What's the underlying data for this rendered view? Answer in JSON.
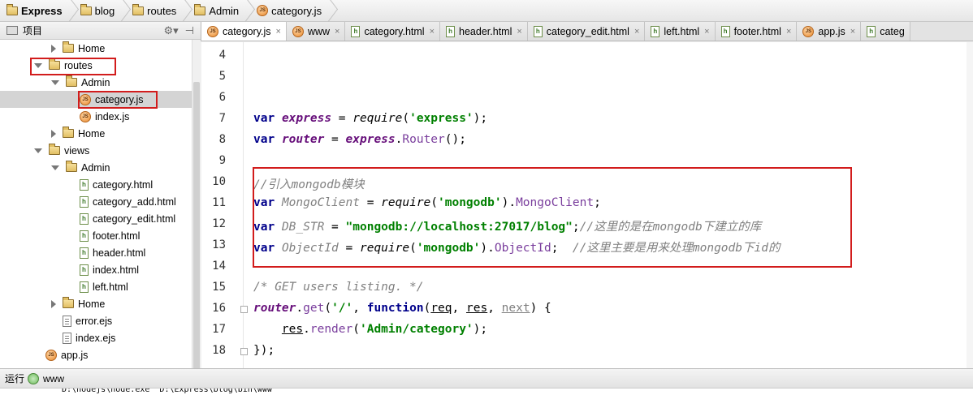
{
  "breadcrumb": [
    "Express",
    "blog",
    "routes",
    "Admin",
    "category.js"
  ],
  "panel": {
    "title": "项目"
  },
  "tree": [
    {
      "label": "Home",
      "depth": 3,
      "arrow": "r",
      "icon": "folder"
    },
    {
      "label": "routes",
      "depth": 2,
      "arrow": "d",
      "icon": "folder"
    },
    {
      "label": "Admin",
      "depth": 3,
      "arrow": "d",
      "icon": "folder"
    },
    {
      "label": "category.js",
      "depth": 4,
      "arrow": "n",
      "icon": "js",
      "selected": true
    },
    {
      "label": "index.js",
      "depth": 4,
      "arrow": "n",
      "icon": "js"
    },
    {
      "label": "Home",
      "depth": 3,
      "arrow": "r",
      "icon": "folder"
    },
    {
      "label": "views",
      "depth": 2,
      "arrow": "d",
      "icon": "folder"
    },
    {
      "label": "Admin",
      "depth": 3,
      "arrow": "d",
      "icon": "folder"
    },
    {
      "label": "category.html",
      "depth": 4,
      "arrow": "n",
      "icon": "html"
    },
    {
      "label": "category_add.html",
      "depth": 4,
      "arrow": "n",
      "icon": "html"
    },
    {
      "label": "category_edit.html",
      "depth": 4,
      "arrow": "n",
      "icon": "html"
    },
    {
      "label": "footer.html",
      "depth": 4,
      "arrow": "n",
      "icon": "html"
    },
    {
      "label": "header.html",
      "depth": 4,
      "arrow": "n",
      "icon": "html"
    },
    {
      "label": "index.html",
      "depth": 4,
      "arrow": "n",
      "icon": "html"
    },
    {
      "label": "left.html",
      "depth": 4,
      "arrow": "n",
      "icon": "html"
    },
    {
      "label": "Home",
      "depth": 3,
      "arrow": "r",
      "icon": "folder"
    },
    {
      "label": "error.ejs",
      "depth": 3,
      "arrow": "n",
      "icon": "ejs"
    },
    {
      "label": "index.ejs",
      "depth": 3,
      "arrow": "n",
      "icon": "ejs"
    },
    {
      "label": "app.js",
      "depth": 2,
      "arrow": "n",
      "icon": "js"
    }
  ],
  "tabs": [
    {
      "label": "category.js",
      "icon": "js",
      "active": true
    },
    {
      "label": "www",
      "icon": "js"
    },
    {
      "label": "category.html",
      "icon": "html"
    },
    {
      "label": "header.html",
      "icon": "html"
    },
    {
      "label": "category_edit.html",
      "icon": "html"
    },
    {
      "label": "left.html",
      "icon": "html"
    },
    {
      "label": "footer.html",
      "icon": "html"
    },
    {
      "label": "app.js",
      "icon": "js"
    },
    {
      "label": "categ",
      "icon": "html"
    }
  ],
  "editor": {
    "current_line": 13,
    "lines": [
      {
        "n": "4",
        "tokens": []
      },
      {
        "n": "5",
        "tokens": []
      },
      {
        "n": "6",
        "tokens": []
      },
      {
        "n": "7",
        "tokens": [
          [
            "kw",
            "var"
          ],
          [
            "t",
            " "
          ],
          [
            "var",
            "express"
          ],
          [
            "t",
            " = "
          ],
          [
            "fn",
            "require"
          ],
          [
            "t",
            "("
          ],
          [
            "str",
            "'express'"
          ],
          [
            "t",
            ");"
          ]
        ]
      },
      {
        "n": "8",
        "tokens": [
          [
            "kw",
            "var"
          ],
          [
            "t",
            " "
          ],
          [
            "var",
            "router"
          ],
          [
            "t",
            " = "
          ],
          [
            "var",
            "express"
          ],
          [
            "t",
            "."
          ],
          [
            "mth",
            "Router"
          ],
          [
            "t",
            "();"
          ]
        ]
      },
      {
        "n": "9",
        "tokens": []
      },
      {
        "n": "10",
        "tokens": [
          [
            "cmt",
            "//引入mongodb模块"
          ]
        ]
      },
      {
        "n": "11",
        "tokens": [
          [
            "kw",
            "var"
          ],
          [
            "t",
            " "
          ],
          [
            "gvar",
            "MongoClient"
          ],
          [
            "t",
            " = "
          ],
          [
            "fn",
            "require"
          ],
          [
            "t",
            "("
          ],
          [
            "str",
            "'mongodb'"
          ],
          [
            "t",
            ")."
          ],
          [
            "mth",
            "MongoClient"
          ],
          [
            "t",
            ";"
          ]
        ]
      },
      {
        "n": "12",
        "tokens": [
          [
            "kw",
            "var"
          ],
          [
            "t",
            " "
          ],
          [
            "gvar",
            "DB_STR"
          ],
          [
            "t",
            " = "
          ],
          [
            "str",
            "\"mongodb://localhost:27017/blog\""
          ],
          [
            "t",
            ";"
          ],
          [
            "cmt",
            "//这里的是在mongodb下建立的库"
          ]
        ]
      },
      {
        "n": "13",
        "tokens": [
          [
            "kw",
            "var"
          ],
          [
            "t",
            " "
          ],
          [
            "gvar",
            "ObjectId"
          ],
          [
            "t",
            " = "
          ],
          [
            "fn",
            "require"
          ],
          [
            "t",
            "("
          ],
          [
            "str",
            "'mongodb'"
          ],
          [
            "t",
            ")."
          ],
          [
            "mth",
            "ObjectId"
          ],
          [
            "t",
            ";  "
          ],
          [
            "cmt",
            "//这里主要是用来处理mongodb下id的"
          ]
        ]
      },
      {
        "n": "14",
        "tokens": []
      },
      {
        "n": "15",
        "tokens": [
          [
            "cmt",
            "/* GET users listing. */"
          ]
        ]
      },
      {
        "n": "16",
        "tokens": [
          [
            "var",
            "router"
          ],
          [
            "t",
            "."
          ],
          [
            "mth",
            "get"
          ],
          [
            "t",
            "("
          ],
          [
            "str",
            "'/'"
          ],
          [
            "t",
            ", "
          ],
          [
            "kw",
            "function"
          ],
          [
            "t",
            "("
          ],
          [
            "u",
            "req"
          ],
          [
            "t",
            ", "
          ],
          [
            "u",
            "res"
          ],
          [
            "t",
            ", "
          ],
          [
            "ug",
            "next"
          ],
          [
            "t",
            ") {"
          ]
        ]
      },
      {
        "n": "17",
        "tokens": [
          [
            "t",
            "    "
          ],
          [
            "u",
            "res"
          ],
          [
            "t",
            "."
          ],
          [
            "mth",
            "render"
          ],
          [
            "t",
            "("
          ],
          [
            "str",
            "'Admin/category'"
          ],
          [
            "t",
            ");"
          ]
        ]
      },
      {
        "n": "18",
        "tokens": [
          [
            "t",
            "});"
          ]
        ]
      }
    ]
  },
  "runbar": {
    "label": "运行",
    "config": "www"
  },
  "console": {
    "line": "\"D:\\nodejs\\node.exe\" D:\\Express\\blog\\bin\\www"
  }
}
